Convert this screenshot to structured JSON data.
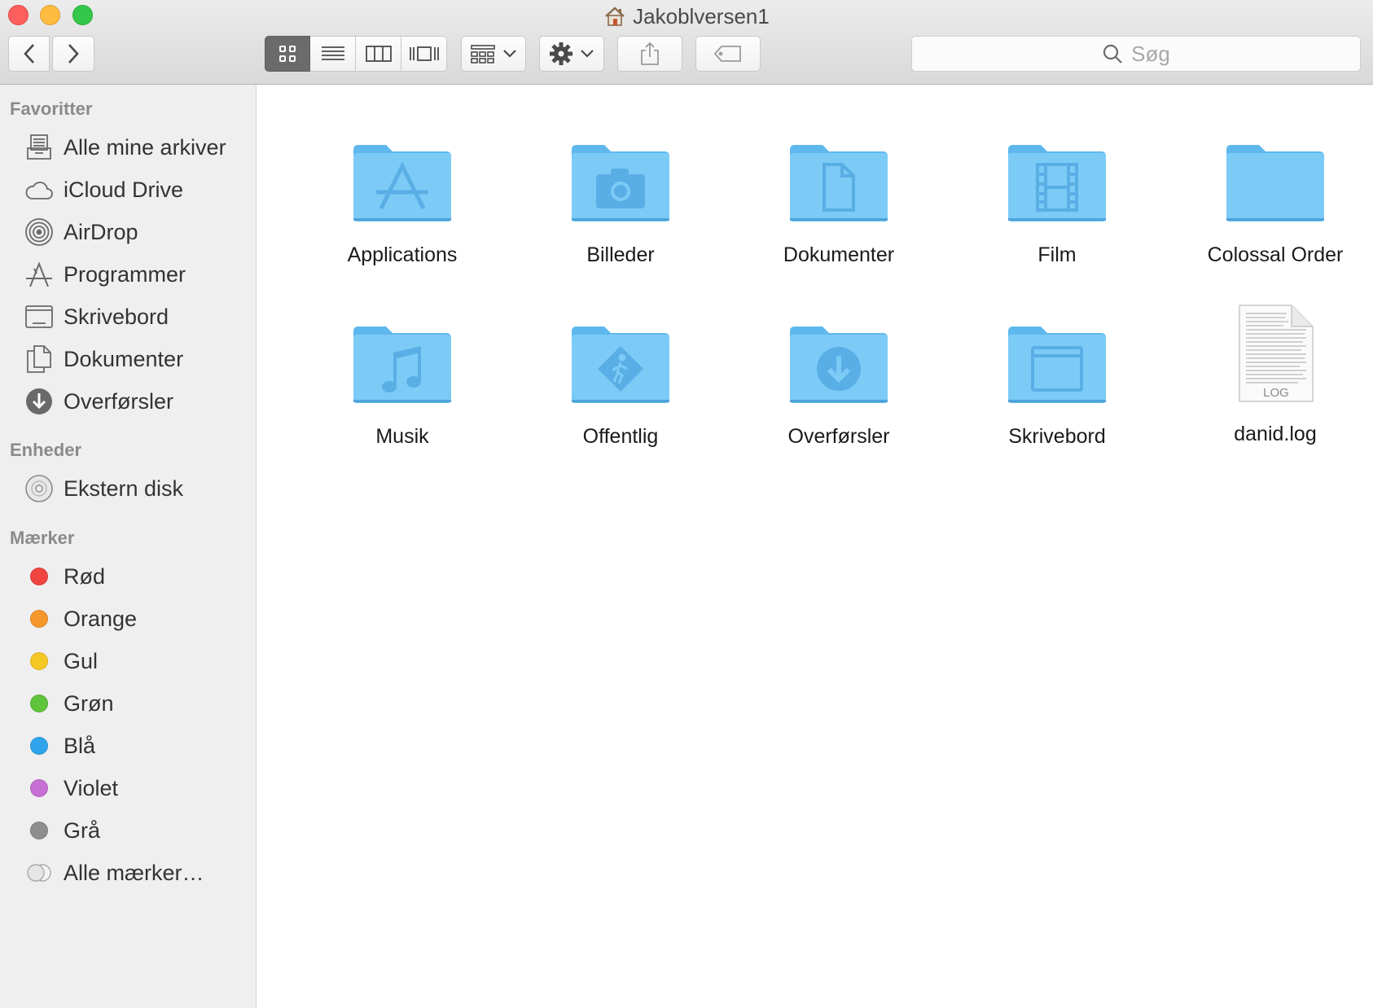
{
  "window": {
    "title": "Jakoblversen1"
  },
  "toolbar": {
    "search_placeholder": "Søg"
  },
  "sidebar": {
    "favorites_heading": "Favoritter",
    "favorites": [
      {
        "label": "Alle mine arkiver",
        "icon": "all-files-icon"
      },
      {
        "label": "iCloud Drive",
        "icon": "cloud-icon"
      },
      {
        "label": "AirDrop",
        "icon": "airdrop-icon"
      },
      {
        "label": "Programmer",
        "icon": "apps-icon"
      },
      {
        "label": "Skrivebord",
        "icon": "desktop-icon"
      },
      {
        "label": "Dokumenter",
        "icon": "documents-icon"
      },
      {
        "label": "Overførsler",
        "icon": "downloads-icon"
      }
    ],
    "devices_heading": "Enheder",
    "devices": [
      {
        "label": "Ekstern disk",
        "icon": "disc-icon"
      }
    ],
    "tags_heading": "Mærker",
    "tags": [
      {
        "label": "Rød",
        "color": "#f0453f"
      },
      {
        "label": "Orange",
        "color": "#f6972b"
      },
      {
        "label": "Gul",
        "color": "#f5c823"
      },
      {
        "label": "Grøn",
        "color": "#5fc43b"
      },
      {
        "label": "Blå",
        "color": "#2fa4ec"
      },
      {
        "label": "Violet",
        "color": "#c76fd4"
      },
      {
        "label": "Grå",
        "color": "#8e8e8e"
      },
      {
        "label": "Alle mærker…",
        "color": "#e0e0e0"
      }
    ]
  },
  "files": [
    {
      "label": "Applications",
      "icon": "folder-applications-icon"
    },
    {
      "label": "Billeder",
      "icon": "folder-pictures-icon"
    },
    {
      "label": "Dokumenter",
      "icon": "folder-documents-icon"
    },
    {
      "label": "Film",
      "icon": "folder-movies-icon"
    },
    {
      "label": "Colossal Order",
      "icon": "folder-icon"
    },
    {
      "label": "Musik",
      "icon": "folder-music-icon"
    },
    {
      "label": "Offentlig",
      "icon": "folder-public-icon"
    },
    {
      "label": "Overførsler",
      "icon": "folder-downloads-icon"
    },
    {
      "label": "Skrivebord",
      "icon": "folder-desktop-icon"
    },
    {
      "label": "danid.log",
      "icon": "log-file-icon",
      "badge": "LOG"
    }
  ]
}
